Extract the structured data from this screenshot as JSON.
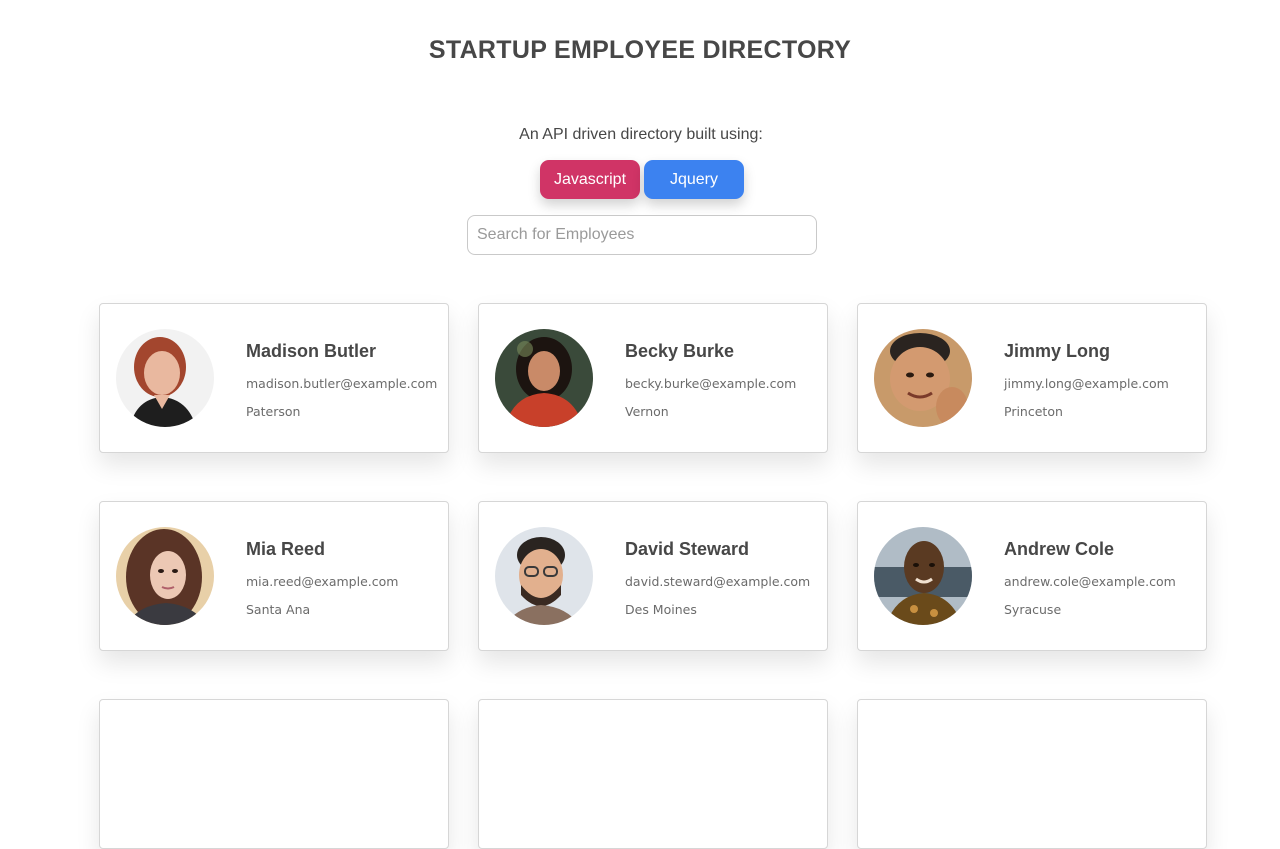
{
  "header": {
    "title": "STARTUP EMPLOYEE DIRECTORY",
    "subtitle": "An API driven directory built using:",
    "tech": [
      {
        "label": "Javascript",
        "color": "#d03466"
      },
      {
        "label": "Jquery",
        "color": "#3c82f0"
      }
    ]
  },
  "search": {
    "placeholder": "Search for Employees",
    "value": ""
  },
  "employees": [
    {
      "name": "Madison Butler",
      "email": "madison.butler@example.com",
      "city": "Paterson",
      "avatar": "user-photo"
    },
    {
      "name": "Becky Burke",
      "email": "becky.burke@example.com",
      "city": "Vernon",
      "avatar": "user-photo"
    },
    {
      "name": "Jimmy Long",
      "email": "jimmy.long@example.com",
      "city": "Princeton",
      "avatar": "user-photo"
    },
    {
      "name": "Mia Reed",
      "email": "mia.reed@example.com",
      "city": "Santa Ana",
      "avatar": "user-photo"
    },
    {
      "name": "David Steward",
      "email": "david.steward@example.com",
      "city": "Des Moines",
      "avatar": "user-photo"
    },
    {
      "name": "Andrew Cole",
      "email": "andrew.cole@example.com",
      "city": "Syracuse",
      "avatar": "user-photo"
    },
    {
      "name": "",
      "email": "",
      "city": "",
      "avatar": "user-photo"
    },
    {
      "name": "",
      "email": "",
      "city": "",
      "avatar": "user-photo"
    },
    {
      "name": "",
      "email": "",
      "city": "",
      "avatar": "user-photo"
    }
  ]
}
